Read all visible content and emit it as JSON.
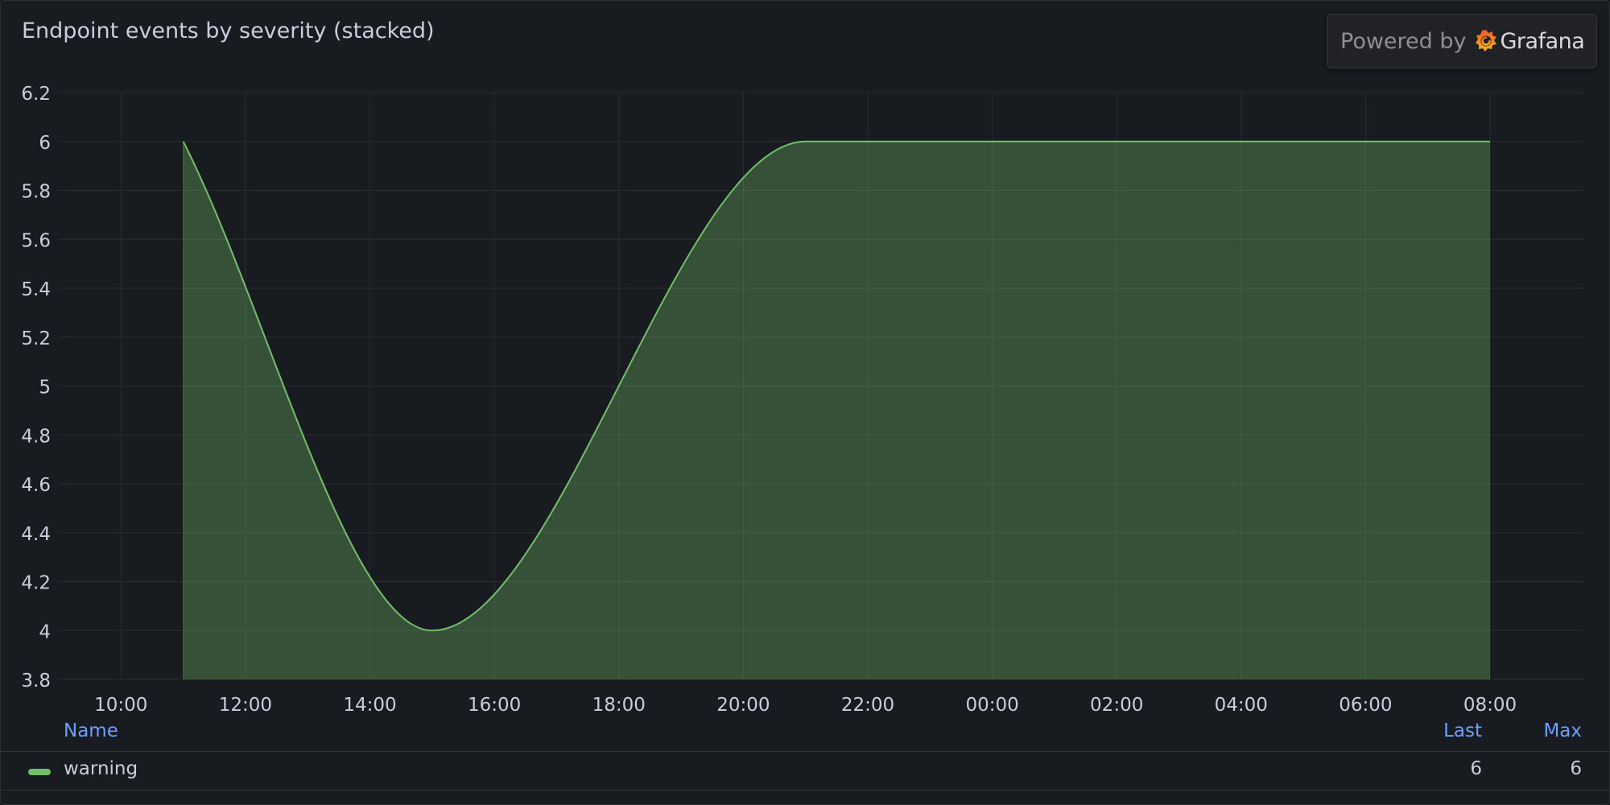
{
  "panel": {
    "title": "Endpoint events by severity (stacked)"
  },
  "branding": {
    "powered_by": "Powered by",
    "brand": "Grafana"
  },
  "legend": {
    "col_name": "Name",
    "col_last": "Last",
    "col_max": "Max",
    "rows": [
      {
        "name": "warning",
        "last": "6",
        "max": "6",
        "color": "#73bf69"
      }
    ]
  },
  "chart_data": {
    "type": "area",
    "title": "Endpoint events by severity (stacked)",
    "xlabel": "",
    "ylabel": "",
    "x_ticks": [
      "10:00",
      "12:00",
      "14:00",
      "16:00",
      "18:00",
      "20:00",
      "22:00",
      "00:00",
      "02:00",
      "04:00",
      "06:00",
      "08:00"
    ],
    "y_ticks": [
      3.8,
      4,
      4.2,
      4.4,
      4.6,
      4.8,
      5,
      5.2,
      5.4,
      5.6,
      5.8,
      6,
      6.2
    ],
    "ylim": [
      3.8,
      6.2
    ],
    "xlim": [
      "09:00",
      "09:30 +1d"
    ],
    "grid": true,
    "legend": "bottom",
    "series": [
      {
        "name": "warning",
        "color": "#73bf69",
        "stacked": true,
        "x": [
          "11:00",
          "15:00",
          "21:00",
          "22:00",
          "00:00",
          "02:00",
          "04:00",
          "06:00",
          "08:00"
        ],
        "values": [
          6,
          4,
          6,
          6,
          6,
          6,
          6,
          6,
          6
        ]
      }
    ]
  }
}
